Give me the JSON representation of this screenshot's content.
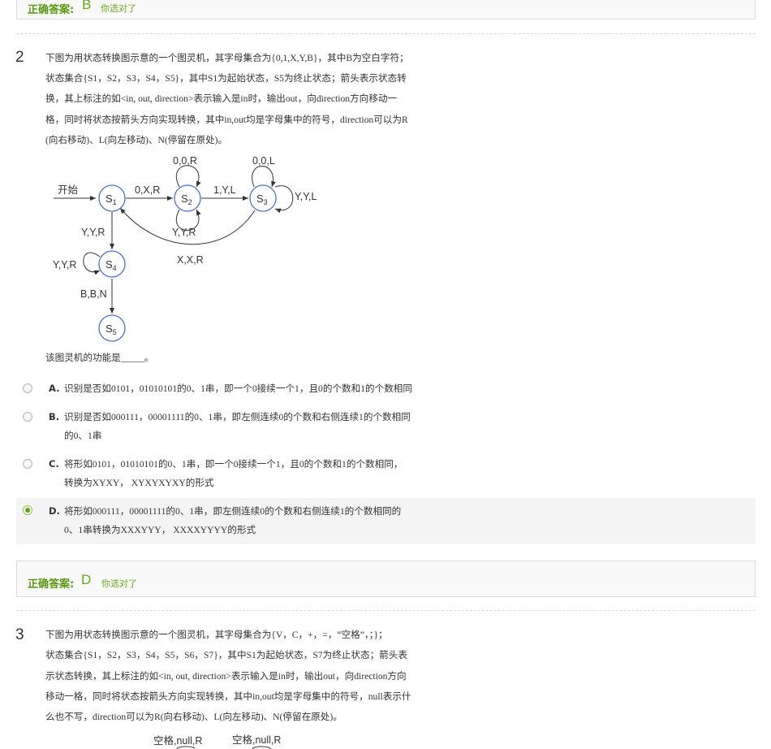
{
  "prev_answer": {
    "label": "正确答案:",
    "letter": "B",
    "note": "你选对了"
  },
  "q2": {
    "number": "2",
    "lines": [
      "下图为用状态转换图示意的一个图灵机，其字母集合为{0,1,X,Y,B}，其中B为空白字符；",
      "状态集合{S1，S2，S3，S4，S5}，其中S1为起始状态，S5为终止状态；箭头表示状态转",
      "换，其上标注的如<in, out, direction>表示输入是in时，输出out，向direction方向移动一",
      "格，同时将状态按箭头方向实现转换，其中in,out均是字母集中的符号，direction可以为R",
      "(向右移动)、L(向左移动)、N(停留在原处)。"
    ],
    "diagram": {
      "start_label": "开始",
      "states": [
        {
          "id": "s1",
          "main": "S",
          "sub": "1"
        },
        {
          "id": "s2",
          "main": "S",
          "sub": "2"
        },
        {
          "id": "s3",
          "main": "S",
          "sub": "3"
        },
        {
          "id": "s4",
          "main": "S",
          "sub": "4"
        },
        {
          "id": "s5",
          "main": "S",
          "sub": "5"
        }
      ],
      "edge_labels": {
        "s1_s2": "0,X,R",
        "s2_loop_top": "0,0,R",
        "s2_loop_bottom": "Y,Y,R",
        "s2_s3": "1,Y,L",
        "s3_loop_top": "0,0,L",
        "s3_loop_right": "Y,Y,L",
        "s3_s1": "X,X,R",
        "s1_s4": "Y,Y,R",
        "s4_loop": "Y,Y,R",
        "s4_s5": "B,B,N"
      },
      "colors": {
        "state_stroke": "#4a72c9",
        "edge": "#333333"
      }
    },
    "prompt": "该图灵机的功能是_____。",
    "options": [
      {
        "letter": "A.",
        "lines": [
          "识别是否如0101，01010101的0、1串，即一个0接续一个1，且0的个数和1的个数相同"
        ],
        "selected": false
      },
      {
        "letter": "B.",
        "lines": [
          "识别是否如000111，00001111的0、1串，即左侧连续0的个数和右侧连续1的个数相同",
          "的0、1串"
        ],
        "selected": false
      },
      {
        "letter": "C.",
        "lines": [
          "将形如0101，01010101的0、1串，即一个0接续一个1，且0的个数和1的个数相同，",
          "转换为XYXY， XYXYXYXY的形式"
        ],
        "selected": false
      },
      {
        "letter": "D.",
        "lines": [
          "将形如000111，00001111的0、1串，即左侧连续0的个数和右侧连续1的个数相同的",
          "0、1串转换为XXXYYY， XXXXYYYY的形式"
        ],
        "selected": true
      }
    ],
    "answer": {
      "label": "正确答案:",
      "letter": "D",
      "note": "你选对了"
    }
  },
  "q3": {
    "number": "3",
    "lines": [
      "下图为用状态转换图示意的一个图灵机，其字母集合为{V，C，+，=，“空格”，；}；",
      "状态集合{S1，S2，S3，S4，S5，S6，S7}，其中S1为起始状态，S7为终止状态；箭头表",
      "示状态转换，其上标注的如<in, out, direction>表示输入是in时，输出out，向direction方向",
      "移动一格，同时将状态按箭头方向实现转换，其中in,out均是字母集中的符号，null表示什",
      "么也不写，direction可以为R(向右移动)、L(向左移动)、N(停留在原处)。"
    ],
    "diagram_labels": [
      "空格,null,R",
      "空格,null,R"
    ]
  }
}
